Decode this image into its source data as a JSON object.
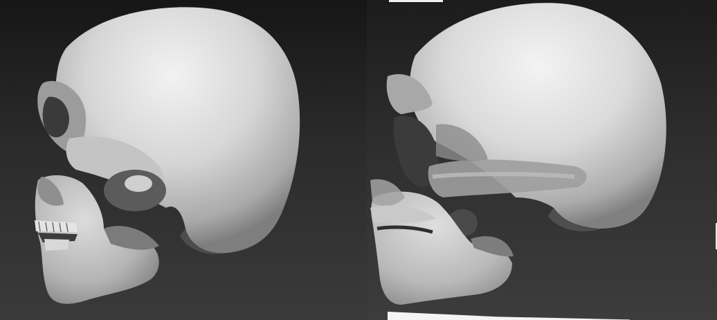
{
  "scene": {
    "left_panel": {
      "subject": "skull-render-left"
    },
    "right_panel": {
      "subject": "skull-render-right"
    },
    "colors": {
      "background_dark": "#161616",
      "background_light": "#3c3c3c",
      "skull_base": "#cfcfcf",
      "skull_highlight": "#f0f0f0",
      "skull_shadow": "#6f6f6f"
    }
  }
}
